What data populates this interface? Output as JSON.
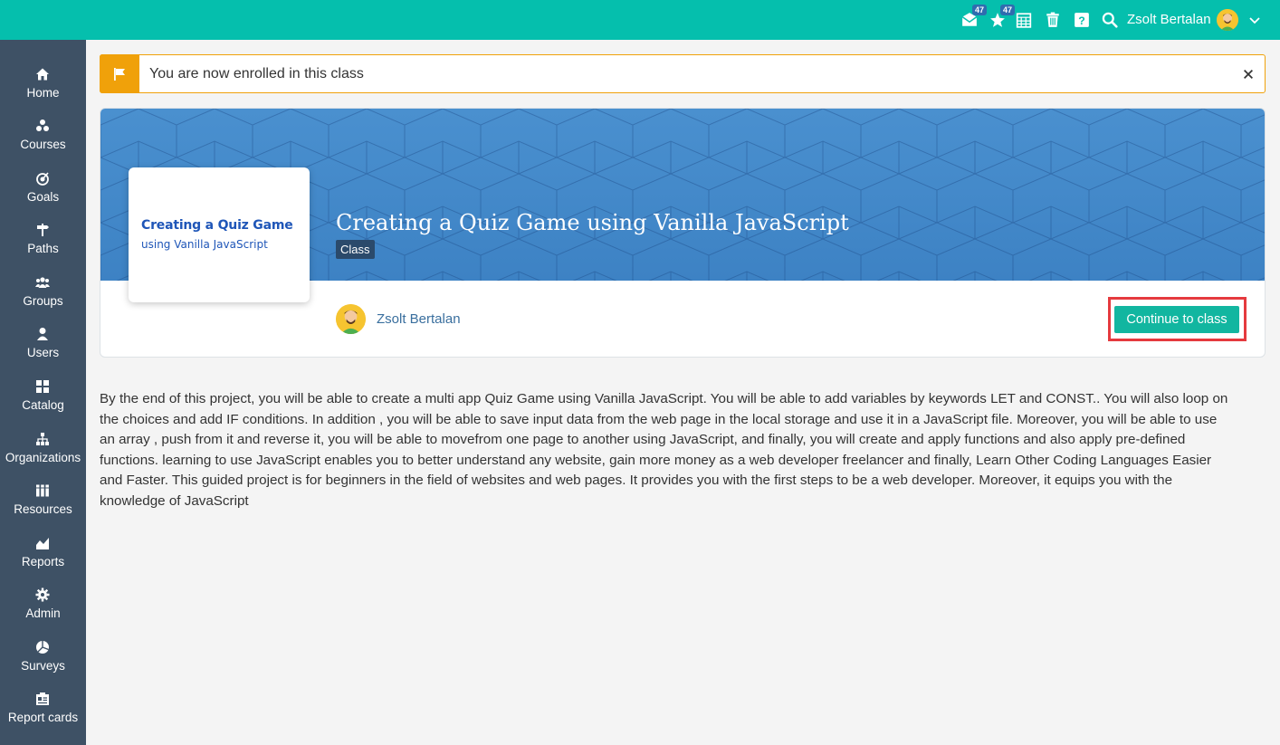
{
  "topbar": {
    "messages_badge": "47",
    "notifications_badge": "47",
    "username": "Zsolt Bertalan",
    "icons": [
      "messages-icon",
      "notifications-icon",
      "calendar-icon",
      "trash-icon",
      "help-icon",
      "search-icon",
      "user-avatar",
      "chevron-down-icon"
    ]
  },
  "sidebar": {
    "items": [
      {
        "label": "Home",
        "icon": "home-icon"
      },
      {
        "label": "Courses",
        "icon": "courses-icon"
      },
      {
        "label": "Goals",
        "icon": "goals-icon"
      },
      {
        "label": "Paths",
        "icon": "paths-icon"
      },
      {
        "label": "Groups",
        "icon": "groups-icon"
      },
      {
        "label": "Users",
        "icon": "users-icon"
      },
      {
        "label": "Catalog",
        "icon": "catalog-icon"
      },
      {
        "label": "Organizations",
        "icon": "organizations-icon"
      },
      {
        "label": "Resources",
        "icon": "resources-icon"
      },
      {
        "label": "Reports",
        "icon": "reports-icon"
      },
      {
        "label": "Admin",
        "icon": "admin-icon"
      },
      {
        "label": "Surveys",
        "icon": "surveys-icon"
      },
      {
        "label": "Report cards",
        "icon": "report-cards-icon"
      }
    ]
  },
  "alert": {
    "text": "You are now enrolled in this class",
    "icon": "flag-icon",
    "close_icon": "close-icon"
  },
  "course": {
    "thumbnail_line1": "Creating a Quiz Game",
    "thumbnail_line2": "using Vanilla JavaScript",
    "title": "Creating a Quiz Game using Vanilla JavaScript",
    "type_tag": "Class",
    "author": "Zsolt Bertalan",
    "continue_label": "Continue to class"
  },
  "description": "By the end of this project, you will be able to create a multi app Quiz Game using Vanilla JavaScript. You will be able to add variables by keywords LET and CONST.. You will also loop on the choices and add IF conditions. In addition , you will be able to save input data from the web page in the local storage and use it in a JavaScript file. Moreover, you will be able to use an array , push from it and reverse it, you will be able to movefrom one page to another using JavaScript, and finally, you will create and apply functions and also apply pre-defined functions. learning to use JavaScript enables you to better understand any website, gain more money as a web developer freelancer and finally, Learn Other Coding Languages Easier and Faster. This guided project is for beginners in the field of websites and web pages. It provides you with the first steps to be a web developer. Moreover, it equips you with the knowledge of JavaScript",
  "colors": {
    "topbar": "#05bfad",
    "sidebar": "#3e5165",
    "alert_accent": "#f0a10a",
    "banner": "#4a90cf",
    "button": "#12b6a0",
    "highlight": "#e53a3e"
  }
}
